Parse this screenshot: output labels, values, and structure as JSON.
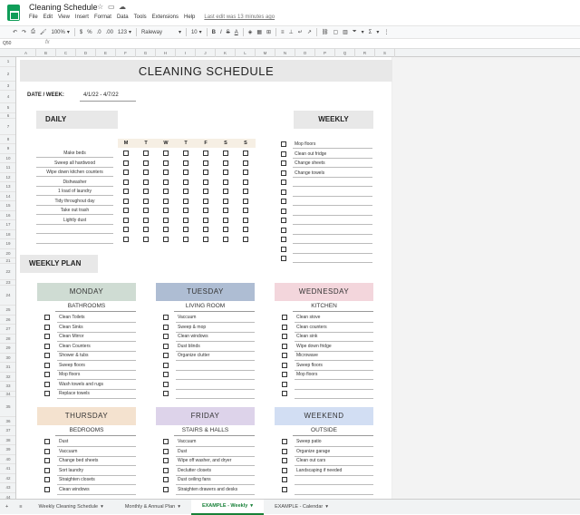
{
  "app": {
    "title": "Cleaning Schedule",
    "menu": [
      "File",
      "Edit",
      "View",
      "Insert",
      "Format",
      "Data",
      "Tools",
      "Extensions",
      "Help"
    ],
    "last_edit": "Last edit was 13 minutes ago"
  },
  "toolbar": {
    "zoom": "100%",
    "currency": "$",
    "percent": "%",
    "dec_less": ".0",
    "dec_more": ".00",
    "format_num": "123",
    "font": "Raleway",
    "font_size": "10",
    "bold": "B",
    "italic": "I",
    "strike": "S",
    "text_color": "A"
  },
  "formula": {
    "cell": "Q50",
    "fx": "fx"
  },
  "columns": [
    "A",
    "B",
    "C",
    "D",
    "E",
    "F",
    "G",
    "H",
    "I",
    "J",
    "K",
    "L",
    "M",
    "N",
    "O",
    "P",
    "Q",
    "R",
    "S"
  ],
  "rows": [
    "1",
    "2",
    "3",
    "4",
    "5",
    "6",
    "7",
    "8",
    "9",
    "10",
    "11",
    "12",
    "13",
    "14",
    "15",
    "16",
    "17",
    "18",
    "19",
    "20",
    "21",
    "22",
    "23",
    "24",
    "25",
    "26",
    "27",
    "28",
    "29",
    "30",
    "31",
    "32",
    "33",
    "34",
    "35",
    "36",
    "37",
    "38",
    "39",
    "40",
    "41",
    "42",
    "43",
    "44",
    "45"
  ],
  "sheet": {
    "title": "CLEANING SCHEDULE",
    "date_label": "DATE / WEEK:",
    "date_value": "4/1/22 - 4/7/22",
    "daily_label": "DAILY",
    "weekly_label": "WEEKLY",
    "weekly_plan_label": "WEEKLY PLAN",
    "days": [
      "M",
      "T",
      "W",
      "T",
      "F",
      "S",
      "S"
    ],
    "daily_tasks": [
      "Make beds",
      "Sweep all hardwood",
      "Wipe down kitchen counters",
      "Dishwasher",
      "1 load of laundry",
      "Tidy throughout day",
      "Take out trash",
      "Lightly dust",
      "",
      ""
    ],
    "weekly_tasks": [
      "Mop floors",
      "Clean out fridge",
      "Change sheets",
      "Change towels",
      "",
      "",
      "",
      "",
      "",
      "",
      "",
      "",
      ""
    ],
    "cards": [
      {
        "day": "MONDAY",
        "area": "BATHROOMS",
        "color": "#cfdcd3",
        "tasks": [
          "Clean Toilets",
          "Clean Sinks",
          "Clean Mirror",
          "Clean Counters",
          "Shower & tubs",
          "Sweep floors",
          "Mop floors",
          "Wash towels and rugs",
          "Replace towels"
        ]
      },
      {
        "day": "TUESDAY",
        "area": "LIVING ROOM",
        "color": "#aebdd3",
        "tasks": [
          "Vaccuum",
          "Sweep & mop",
          "Clean windows",
          "Dust blinds",
          "Organize clutter",
          "",
          "",
          "",
          ""
        ]
      },
      {
        "day": "WEDNESDAY",
        "area": "KITCHEN",
        "color": "#f3d6dc",
        "tasks": [
          "Clean stove",
          "Clean counters",
          "Clean sink",
          "Wipe down fridge",
          "Microwave",
          "Sweep floors",
          "Mop floors",
          "",
          ""
        ]
      },
      {
        "day": "THURSDAY",
        "area": "BEDROOMS",
        "color": "#f4e2cf",
        "tasks": [
          "Dust",
          "Vaccuum",
          "Change bed sheets",
          "Sort laundry",
          "Straighten closets",
          "Clean windows"
        ]
      },
      {
        "day": "FRIDAY",
        "area": "STAIRS & HALLS",
        "color": "#ddd3ea",
        "tasks": [
          "Vaccuum",
          "Dust",
          "Wipe off washer, and dryer",
          "Declutter closets",
          "Dust ceiling fans",
          "Straighten drawers and desks"
        ]
      },
      {
        "day": "WEEKEND",
        "area": "OUTSIDE",
        "color": "#d2def3",
        "tasks": [
          "Sweep patio",
          "Organize garage",
          "Clean out cars",
          "Landscaping if needed",
          "",
          ""
        ]
      }
    ]
  },
  "tabs": {
    "add": "+",
    "list": "≡",
    "items": [
      "Weekly Cleaning Schedule",
      "Monthly & Annual Plan",
      "EXAMPLE - Weekly",
      "EXAMPLE - Calendar"
    ],
    "active": 2
  }
}
